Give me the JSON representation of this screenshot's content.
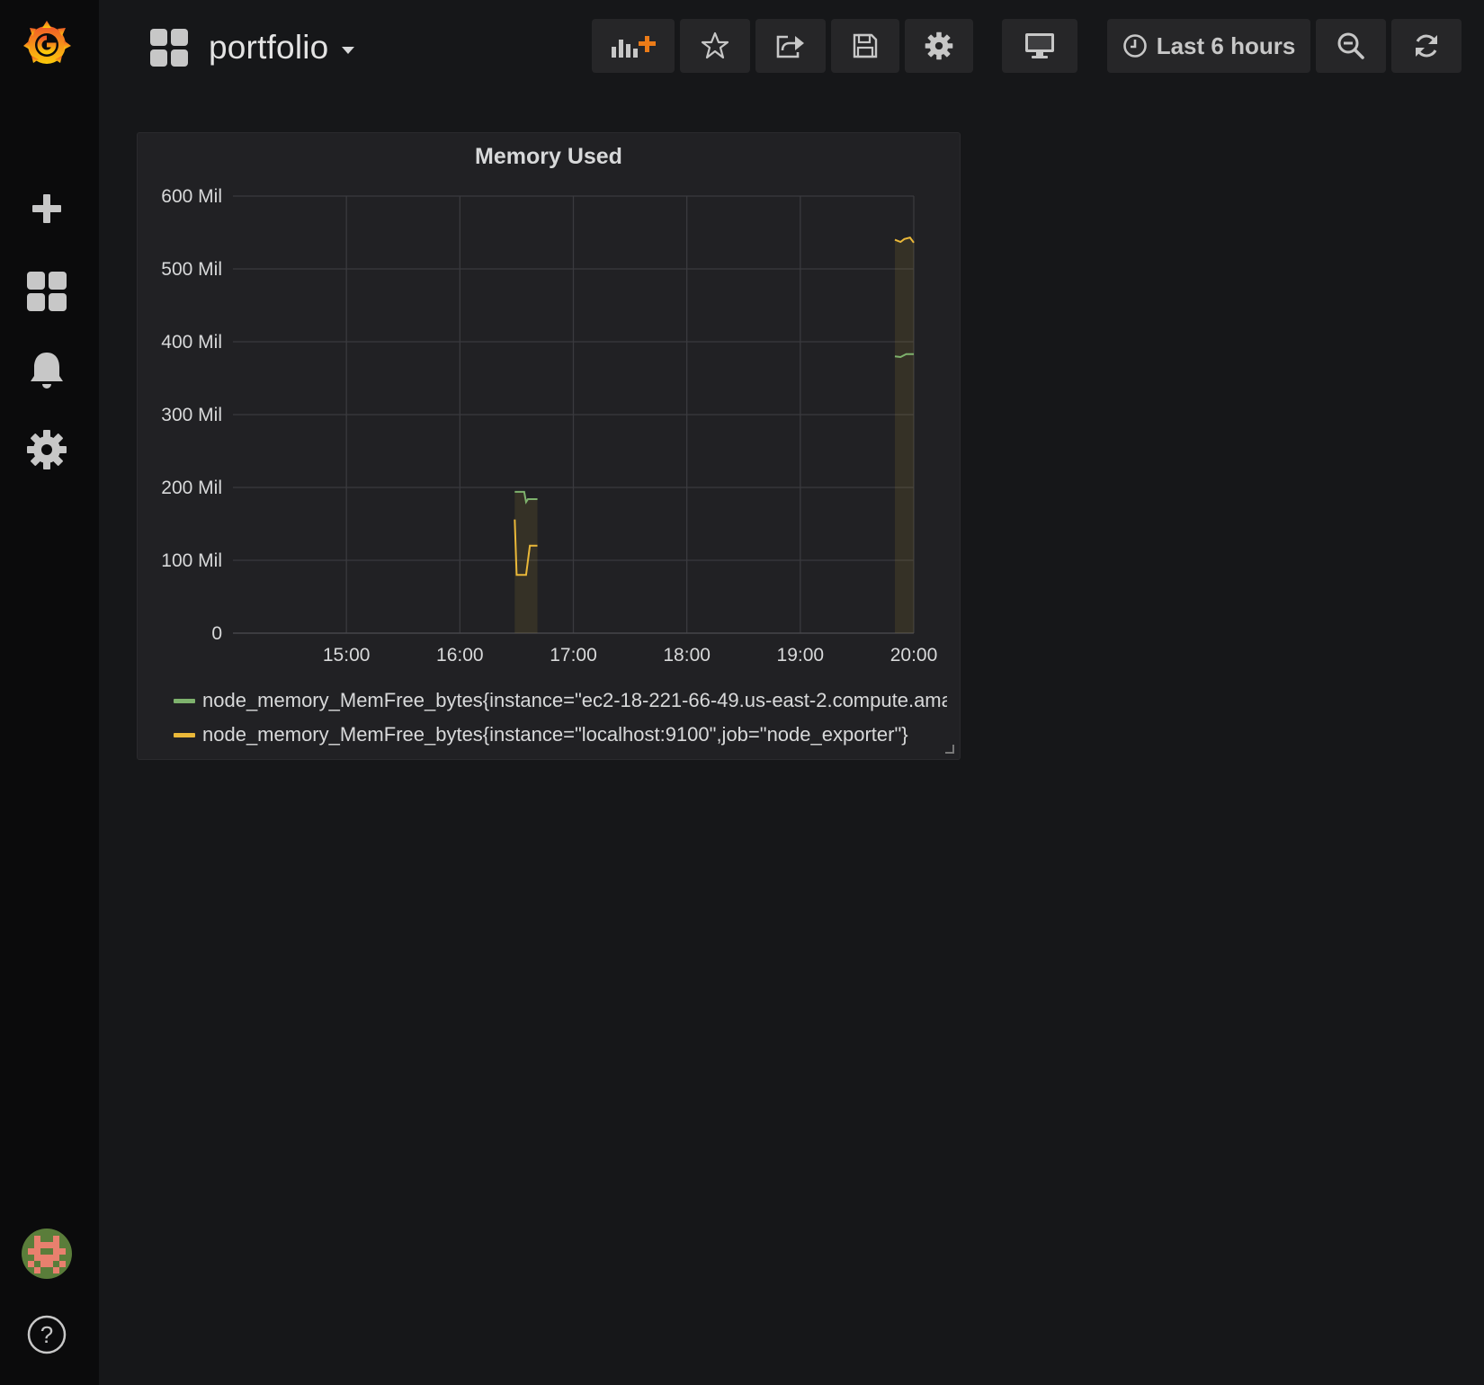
{
  "dashboard": {
    "title": "portfolio"
  },
  "toolbar": {
    "time_range_label": "Last 6 hours",
    "icons": [
      "add-panel-icon",
      "star-icon",
      "share-icon",
      "save-icon",
      "gear-icon",
      "tv-icon",
      "clock-icon",
      "zoom-out-icon",
      "refresh-icon"
    ]
  },
  "sidebar": {
    "items": [
      "grafana-logo",
      "plus-icon",
      "dashboards-icon",
      "alerting-bell-icon",
      "configuration-gear-icon",
      "user-avatar",
      "help-icon"
    ]
  },
  "colors": {
    "series_green": "#7eb26d",
    "series_yellow": "#eab839",
    "accent": "#eb7b18"
  },
  "panel": {
    "title": "Memory Used"
  },
  "chart_data": {
    "type": "line",
    "title": "Memory Used",
    "xlabel": "",
    "ylabel": "",
    "ylim": [
      0,
      600
    ],
    "yticks": [
      0,
      100,
      200,
      300,
      400,
      500,
      600
    ],
    "ytick_labels": [
      "0",
      "100 Mil",
      "200 Mil",
      "300 Mil",
      "400 Mil",
      "500 Mil",
      "600 Mil"
    ],
    "x_range": [
      "14:00",
      "20:00"
    ],
    "xticks": [
      "15:00",
      "16:00",
      "17:00",
      "18:00",
      "19:00",
      "20:00"
    ],
    "grid": true,
    "legend_position": "bottom",
    "series": [
      {
        "name": "node_memory_MemFree_bytes{instance=\"ec2-18-221-66-49.us-east-2.compute.ama",
        "color": "#7eb26d",
        "segments": [
          [
            [
              "16:29",
              194
            ],
            [
              "16:34",
              194
            ],
            [
              "16:35",
              180
            ],
            [
              "16:36",
              184
            ],
            [
              "16:41",
              184
            ]
          ],
          [
            [
              "19:50",
              380
            ],
            [
              "19:53",
              379
            ],
            [
              "19:56",
              383
            ],
            [
              "20:00",
              383
            ]
          ]
        ]
      },
      {
        "name": "node_memory_MemFree_bytes{instance=\"localhost:9100\",job=\"node_exporter\"}",
        "color": "#eab839",
        "segments": [
          [
            [
              "16:29",
              156
            ],
            [
              "16:30",
              80
            ],
            [
              "16:35",
              80
            ],
            [
              "16:37",
              120
            ],
            [
              "16:41",
              120
            ]
          ],
          [
            [
              "19:50",
              540
            ],
            [
              "19:53",
              537
            ],
            [
              "19:55",
              541
            ],
            [
              "19:58",
              543
            ],
            [
              "20:00",
              536
            ]
          ]
        ]
      }
    ]
  }
}
